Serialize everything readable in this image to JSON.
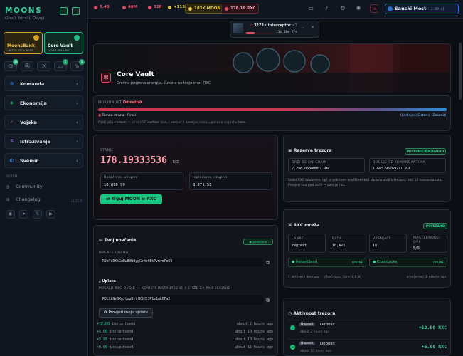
{
  "sidebar": {
    "logo": "MOONS",
    "subtitle": "Gradi, Istraži, Osvoji",
    "cards": [
      {
        "title": "MoonsBank",
        "sub": "UNITED SYS • MOON"
      },
      {
        "title": "Core Vault",
        "sub": "OUTER RIM • RXC"
      }
    ],
    "quick_badges": [
      "34",
      "",
      "",
      "5",
      "0"
    ],
    "nav": [
      {
        "label": "Komanda",
        "icon": "globe-icon"
      },
      {
        "label": "Ekonomija",
        "icon": "coins-icon"
      },
      {
        "label": "Vojska",
        "icon": "rocket-icon"
      },
      {
        "label": "Istraživanje",
        "icon": "flask-icon"
      },
      {
        "label": "Svemir",
        "icon": "planet-icon"
      }
    ],
    "system_label": "SISTEM",
    "links": [
      {
        "label": "Community"
      },
      {
        "label": "Changelog"
      }
    ],
    "version": "v1.15.0"
  },
  "topbar": {
    "stats": [
      "5.48",
      "48M",
      "318",
      "+115K",
      "183K MOON",
      "178.19 RXC"
    ],
    "location": "Sanski Most",
    "location_time": "[1:49:4]"
  },
  "notification": {
    "title": "3273× Interceptor",
    "count": "×2",
    "timer": "11h 58m 27s"
  },
  "hero": {
    "title": "Core Vault",
    "subtitle": "Drevna jezgrena energija, čuvana na tvoje ime · RXC"
  },
  "alignment": {
    "label": "PRIPADNOST",
    "value": "Odmetnik",
    "left": "Tamna strana · Pirati",
    "right": "Ujedinjeni Sistemi · Zakoniti",
    "note": "Pirati jašu s tobom — ali te USF izvršioci love, i padneš li dovoljno nisko, ujedinice se protiv tebe."
  },
  "balance": {
    "label": "STANJE",
    "value": "178.19333536",
    "unit": "RXC",
    "paid_in_label": "Uplaćeno, ukupno",
    "paid_in": "10,890.90",
    "paid_out_label": "Isplaćeno, ukupno",
    "paid_out": "8,271.51",
    "trade_button": "Trguj MOON ⇄ RXC"
  },
  "reserve": {
    "title": "Rezerve trezora",
    "badge": "POTPUNO POKRIVENO",
    "onchain_label": "DRŽI SE ON-CHAIN",
    "onchain": "2,298.06300807 RXC",
    "owed_label": "DUGUJE SE KOMANDANTIMA",
    "owed": "1,685.96769211 RXC",
    "note": "Svaki RXC odobren u igri je pokriven novčićem koji stvarno stoji u trezoru, kod 12 komandanata. Provjeri kad god želiš — zato je i tu."
  },
  "wallet": {
    "title": "Tvoj novčanik",
    "status": "povezano",
    "payout_label": "ISPLATE IDU NA",
    "payout_address": "R9oTeDKkGxBw8XWdygGzHotEkPvurmPeS9",
    "deposit_title": "Uplata",
    "deposit_label": "POŠALJI RXC OVDJE — KORISTI INSTANTSEND I STIŽE ZA PAR SEKUNDI",
    "deposit_address": "RBtXLNzBXoJtzgBztfK9H33P1z1qLEFa2",
    "check_button": "Provjeri moju uplatu",
    "txs": [
      {
        "amt": "+12.00",
        "type": "instantsend",
        "time": "about 2 hours ago"
      },
      {
        "amt": "+5.00",
        "type": "instantsend",
        "time": "about 10 hours ago"
      },
      {
        "amt": "+5.95",
        "type": "instantsend",
        "time": "about 10 hours ago"
      },
      {
        "amt": "+6.00",
        "type": "instantsend",
        "time": "about 12 hours ago"
      }
    ]
  },
  "network": {
    "title": "RXC mreža",
    "badge": "POVEZANO",
    "cells": [
      {
        "label": "LANAC",
        "value": "regtest"
      },
      {
        "label": "BLOK",
        "value": "10,493"
      },
      {
        "label": "VRŠNJACI",
        "value": "18"
      },
      {
        "label": "MASTERNODE-OVI",
        "value": "5/5"
      }
    ],
    "features": [
      {
        "name": "InstantSend",
        "state": "ONLINE"
      },
      {
        "name": "ChainLocks",
        "state": "ONLINE"
      }
    ],
    "quorums": "2 aktivnih kvoruma · /RuxCrypto Core:1.0.0/",
    "verified": "provjereno 1 minute ago"
  },
  "activity": {
    "title": "Aktivnost trezora",
    "items": [
      {
        "tag": "Deposit",
        "title": "Deposit",
        "time": "about 2 hours ago",
        "amount": "+12.00 RXC"
      },
      {
        "tag": "Deposit",
        "title": "Deposit",
        "time": "about 10 hours ago",
        "amount": "+5.00 RXC"
      }
    ]
  },
  "colors": {
    "accent": "#18c47f",
    "danger": "#d94c63",
    "brand": "#37d39a",
    "blue": "#2c6fd8"
  }
}
